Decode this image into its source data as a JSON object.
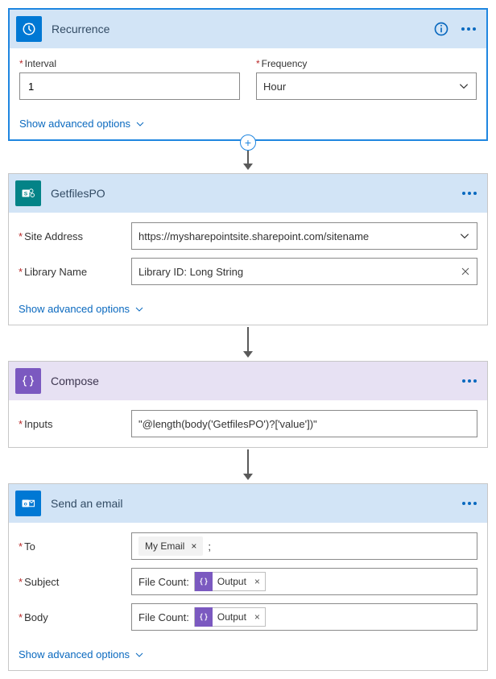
{
  "recurrence": {
    "title": "Recurrence",
    "interval_label": "Interval",
    "interval_value": "1",
    "frequency_label": "Frequency",
    "frequency_value": "Hour",
    "advanced": "Show advanced options"
  },
  "getfiles": {
    "title": "GetfilesPO",
    "site_label": "Site Address",
    "site_value": "https://mysharepointsite.sharepoint.com/sitename",
    "library_label": "Library Name",
    "library_value": "Library ID: Long String",
    "advanced": "Show advanced options"
  },
  "compose": {
    "title": "Compose",
    "inputs_label": "Inputs",
    "inputs_value": "\"@length(body('GetfilesPO')?['value'])\""
  },
  "email": {
    "title": "Send an email",
    "to_label": "To",
    "to_token": "My Email",
    "to_sep": ";",
    "subject_label": "Subject",
    "body_label": "Body",
    "prefix": "File Count:",
    "output_token": "Output",
    "advanced": "Show advanced options"
  }
}
